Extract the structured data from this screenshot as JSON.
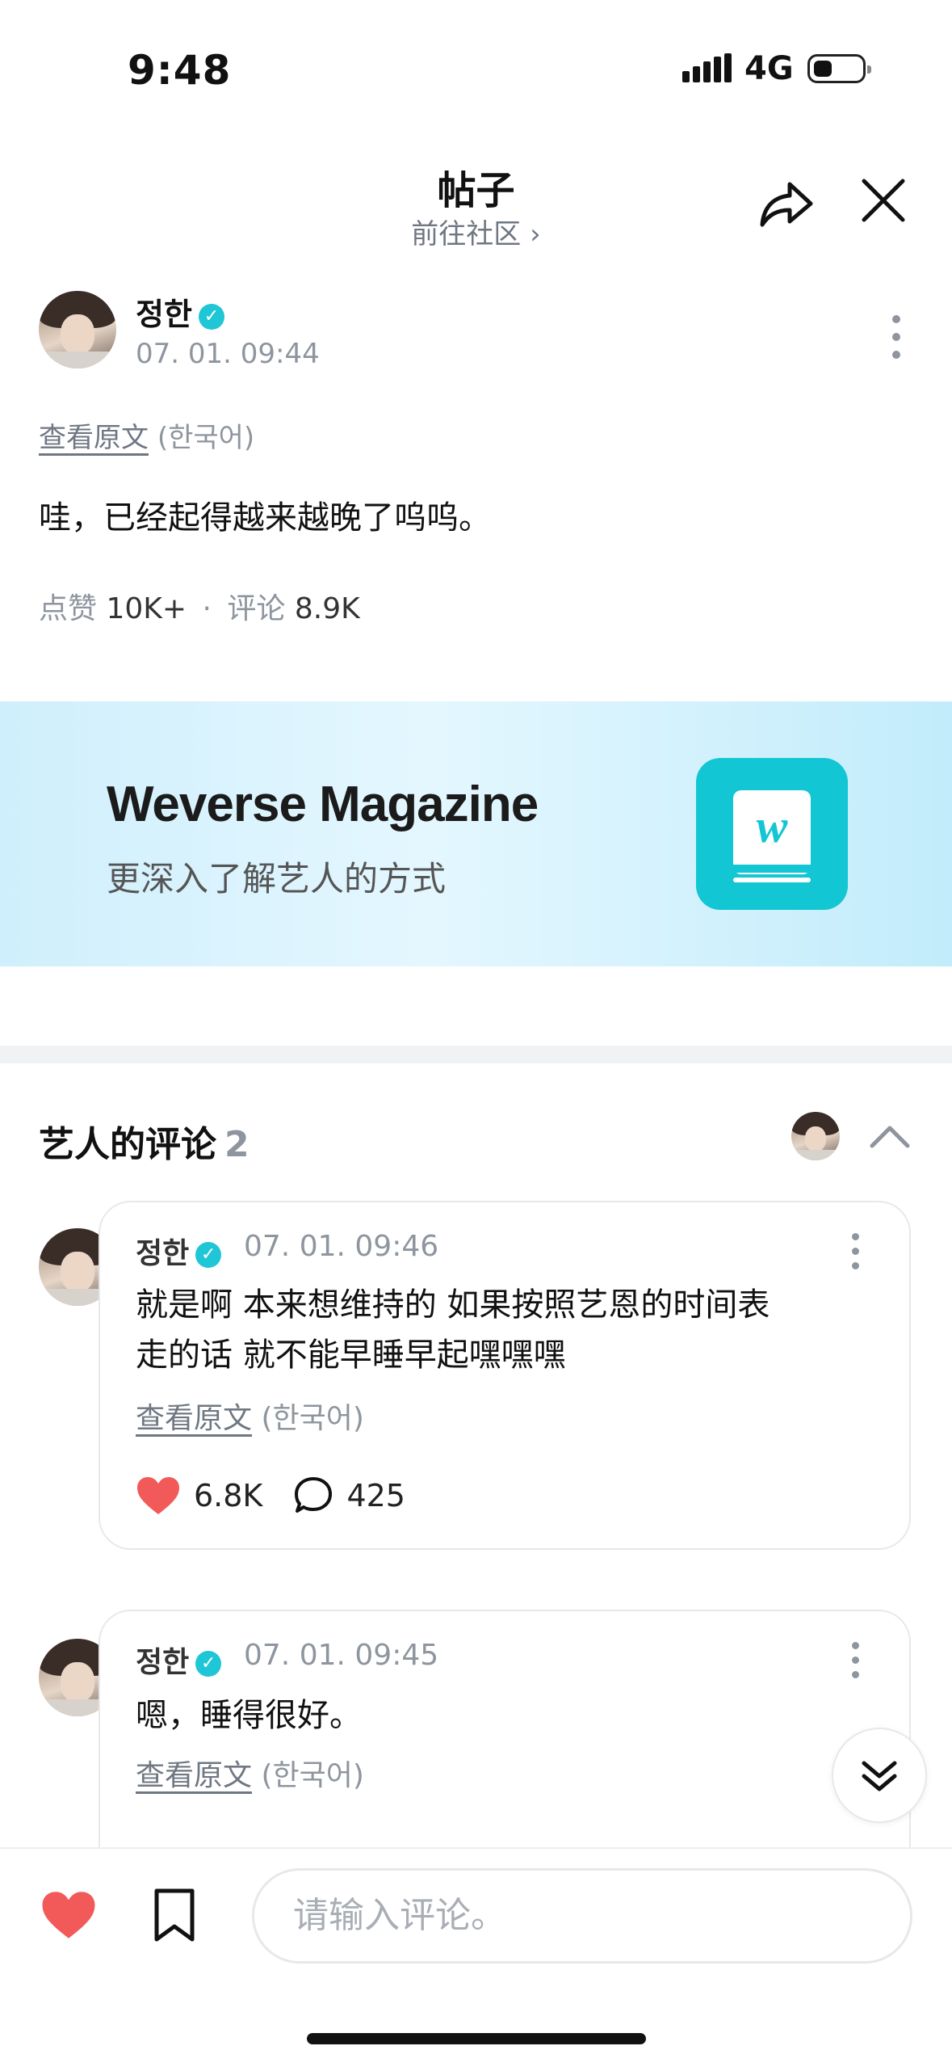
{
  "status_bar": {
    "time": "9:48",
    "network": "4G"
  },
  "header": {
    "title": "帖子",
    "community_link": "前往社区 ›"
  },
  "post": {
    "author": "정한",
    "date": "07. 01. 09:44",
    "view_original": "查看原文",
    "language": "(한국어)",
    "body": "哇，已经起得越来越晚了呜呜。",
    "likes_label": "点赞",
    "likes_count": "10K+",
    "separator": "·",
    "comments_label": "评论",
    "comments_count": "8.9K"
  },
  "banner": {
    "title": "Weverse Magazine",
    "subtitle": "更深入了解艺人的方式",
    "logo_letter": "w"
  },
  "artist_comments": {
    "title": "艺人的评论",
    "count": "2",
    "items": [
      {
        "author": "정한",
        "date": "07. 01. 09:46",
        "body_line1": "就是啊 本来想维持的 如果按照艺恩的时间表",
        "body_line2": "走的话 就不能早睡早起嘿嘿嘿",
        "view_original": "查看原文",
        "language": "(한국어)",
        "likes": "6.8K",
        "replies": "425"
      },
      {
        "author": "정한",
        "date": "07. 01. 09:45",
        "body_line1": "嗯，睡得很好。",
        "view_original": "查看原文",
        "language": "(한국어)"
      }
    ]
  },
  "composer": {
    "placeholder": "请输入评论。"
  },
  "colors": {
    "accent": "#12c6d4",
    "heart": "#f25a5a",
    "muted": "#8e959e"
  }
}
